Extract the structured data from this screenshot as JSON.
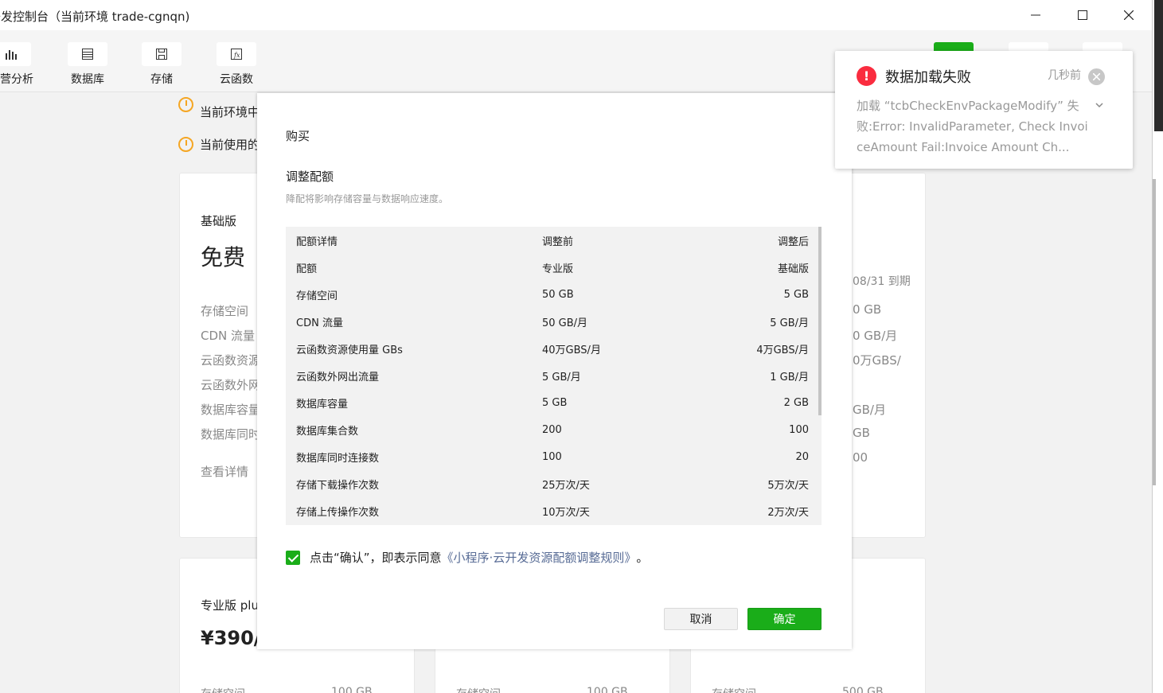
{
  "window": {
    "title": "开发控制台（当前环境 trade-cgnqn)",
    "title_visible": "开发控制台（当前环境 trade-cgnqn)",
    "min": "—",
    "max": "☐",
    "close": "✕"
  },
  "toolbar": {
    "items": [
      {
        "label": "运营分析",
        "icon": "bar-chart-icon"
      },
      {
        "label": "数据库",
        "icon": "database-icon"
      },
      {
        "label": "存储",
        "icon": "save-icon"
      },
      {
        "label": "云函数",
        "icon": "function-icon"
      }
    ]
  },
  "background": {
    "notice1": "当前环境中的",
    "notice2": "当前使用的",
    "basic": {
      "plan_label": "基础版",
      "price": "免费",
      "rows": [
        "存储空间",
        "CDN 流量",
        "云函数资源",
        "云函数外网",
        "数据库容量",
        "数据库同时"
      ],
      "detail_link": "查看详情"
    },
    "right_card": {
      "expiry": "08/31 到期",
      "rows": [
        "0 GB",
        "0 GB/月",
        "0万GBS/",
        "GB/月",
        "GB",
        "00"
      ]
    },
    "pro_plus": {
      "plan_label": "专业版 plus",
      "price": "¥390/"
    },
    "bottom_rows": [
      {
        "label": "存储空间",
        "value": "100 GB"
      },
      {
        "label": "存储空间",
        "value": "100 GB"
      },
      {
        "label": "存储空间",
        "value": "500 GB"
      }
    ]
  },
  "modal": {
    "title": "购买",
    "section_title": "调整配额",
    "section_desc": "降配将影响存储容量与数据响应速度。",
    "table": {
      "headers": [
        "配额详情",
        "调整前",
        "调整后"
      ],
      "rows": [
        [
          "配额",
          "专业版",
          "基础版"
        ],
        [
          "存储空间",
          "50 GB",
          "5 GB"
        ],
        [
          "CDN 流量",
          "50 GB/月",
          "5 GB/月"
        ],
        [
          "云函数资源使用量 GBs",
          "40万GBS/月",
          "4万GBS/月"
        ],
        [
          "云函数外网出流量",
          "5 GB/月",
          "1 GB/月"
        ],
        [
          "数据库容量",
          "5 GB",
          "2 GB"
        ],
        [
          "数据库集合数",
          "200",
          "100"
        ],
        [
          "数据库同时连接数",
          "100",
          "20"
        ],
        [
          "存储下载操作次数",
          "25万次/天",
          "5万次/天"
        ],
        [
          "存储上传操作次数",
          "10万次/天",
          "2万次/天"
        ]
      ]
    },
    "agree_text": "点击“确认”，即表示同意",
    "agree_link": "《小程序·云开发资源配额调整规则》",
    "agree_end": "。",
    "cancel_label": "取消",
    "ok_label": "确定"
  },
  "notification": {
    "title": "数据加载失败",
    "time": "几秒前",
    "body": "加载 “tcbCheckEnvPackageModify” 失败:Error: InvalidParameter, Check InvoiceAmount Fail:Invoice Amount Ch...",
    "icon": "error-icon"
  },
  "colors": {
    "accent": "#1aad19",
    "link": "#576b95",
    "error": "#fa2c3f",
    "warning": "#f5a623"
  }
}
